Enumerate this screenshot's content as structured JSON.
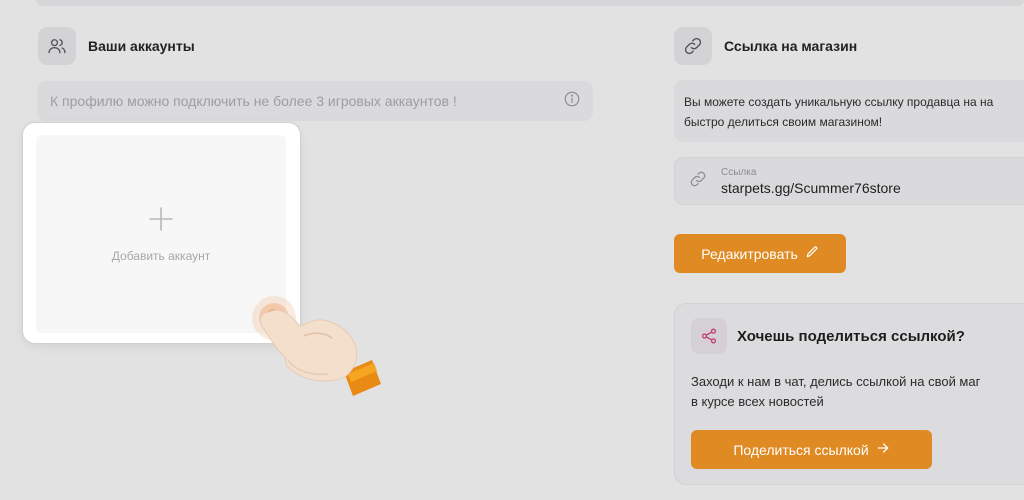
{
  "accounts": {
    "title": "Ваши аккаунты",
    "notice": "К профилю можно подключить не более 3 игровых аккаунтов !",
    "add_label": "Добавить аккаунт"
  },
  "store": {
    "title": "Ссылка на магазин",
    "desc_line1": "Вы можете создать уникальную ссылку продавца на на",
    "desc_line2": "быстро делиться своим магазином!",
    "link_label": "Ссылка",
    "link_value": "starpets.gg/Scummer76store",
    "edit_label": "Редакитровать"
  },
  "share": {
    "title": "Хочешь поделиться ссылкой?",
    "desc_line1": "Заходи к нам в чат, делись ссылкой на свой маг",
    "desc_line2": "в курсе всех новостей",
    "button_label": "Поделиться ссылкой"
  },
  "colors": {
    "accent": "#df8a22",
    "share_icon": "#c2407e",
    "background": "#e2e2e3"
  },
  "icons": {
    "accounts": "users-icon",
    "notice": "info-icon",
    "add": "plus-icon",
    "store": "link-icon",
    "link_field": "link-icon",
    "edit": "pencil-icon",
    "share": "share-icon",
    "share_button": "arrow-right-icon",
    "pointer": "tap-hand-icon"
  }
}
